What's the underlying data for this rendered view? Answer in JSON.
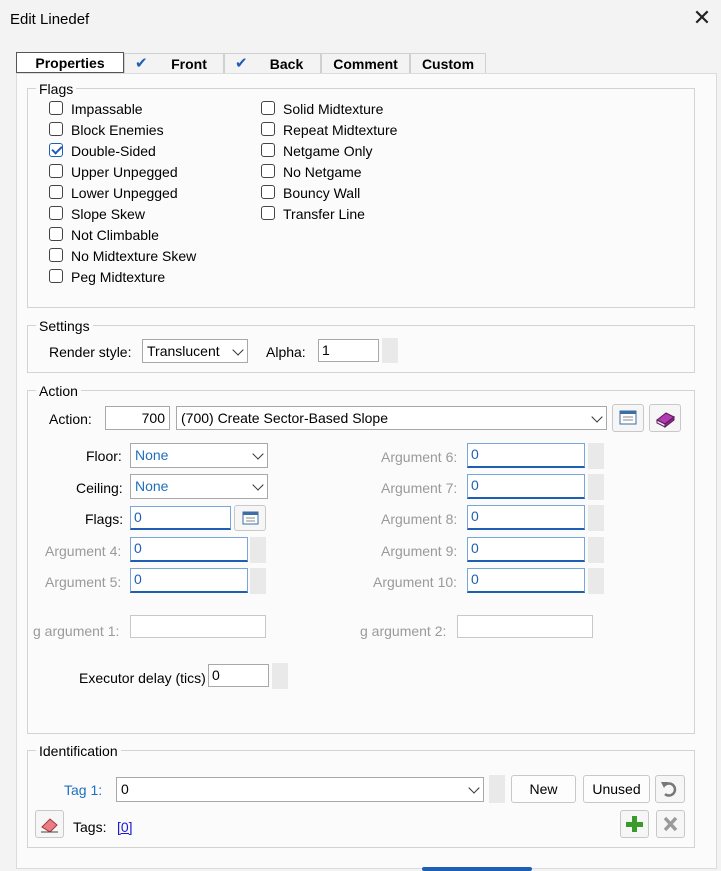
{
  "window": {
    "title": "Edit Linedef",
    "close_icon": "close-icon"
  },
  "tabs": [
    {
      "label": "Properties",
      "active": true,
      "checked": false
    },
    {
      "label": "Front",
      "active": false,
      "checked": true
    },
    {
      "label": "Back",
      "active": false,
      "checked": true
    },
    {
      "label": "Comment",
      "active": false,
      "checked": false
    },
    {
      "label": "Custom",
      "active": false,
      "checked": false
    }
  ],
  "flags": {
    "title": "Flags",
    "left": [
      {
        "label": "Impassable",
        "checked": false
      },
      {
        "label": "Block Enemies",
        "checked": false
      },
      {
        "label": "Double-Sided",
        "checked": true
      },
      {
        "label": "Upper Unpegged",
        "checked": false
      },
      {
        "label": "Lower Unpegged",
        "checked": false
      },
      {
        "label": "Slope Skew",
        "checked": false
      },
      {
        "label": "Not Climbable",
        "checked": false
      },
      {
        "label": "No Midtexture Skew",
        "checked": false
      },
      {
        "label": "Peg Midtexture",
        "checked": false
      }
    ],
    "right": [
      {
        "label": "Solid Midtexture",
        "checked": false
      },
      {
        "label": "Repeat Midtexture",
        "checked": false
      },
      {
        "label": "Netgame Only",
        "checked": false
      },
      {
        "label": "No Netgame",
        "checked": false
      },
      {
        "label": "Bouncy Wall",
        "checked": false
      },
      {
        "label": "Transfer Line",
        "checked": false
      }
    ]
  },
  "settings": {
    "title": "Settings",
    "render_style_label": "Render style:",
    "render_style_value": "Translucent",
    "alpha_label": "Alpha:",
    "alpha_value": "1"
  },
  "action": {
    "title": "Action",
    "action_label": "Action:",
    "action_number": "700",
    "action_value": "(700) Create Sector-Based Slope",
    "floor_label": "Floor:",
    "floor_value": "None",
    "ceiling_label": "Ceiling:",
    "ceiling_value": "None",
    "flags_label": "Flags:",
    "flags_value": "0",
    "arg4_label": "Argument 4:",
    "arg4_value": "0",
    "arg5_label": "Argument 5:",
    "arg5_value": "0",
    "arg6_label": "Argument 6:",
    "arg6_value": "0",
    "arg7_label": "Argument 7:",
    "arg7_value": "0",
    "arg8_label": "Argument 8:",
    "arg8_value": "0",
    "arg9_label": "Argument 9:",
    "arg9_value": "0",
    "arg10_label": "Argument 10:",
    "arg10_value": "0",
    "sarg1_label": "g argument 1:",
    "sarg1_value": "",
    "sarg2_label": "g argument 2:",
    "sarg2_value": "",
    "delay_label": "Executor delay (tics)",
    "delay_value": "0"
  },
  "identification": {
    "title": "Identification",
    "tag_label": "Tag 1:",
    "tag_value": "0",
    "new_label": "New",
    "unused_label": "Unused",
    "tags_label": "Tags:",
    "tags_link": "[0]"
  },
  "colors": {
    "accent": "#1f5fb3",
    "link": "#1f6fbf",
    "disabled": "#9a9a9a"
  }
}
